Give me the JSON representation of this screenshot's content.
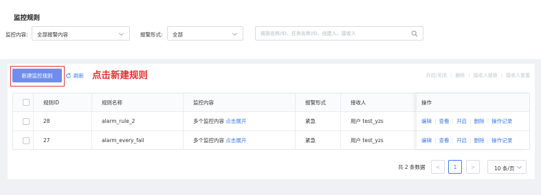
{
  "page": {
    "title": "监控规则"
  },
  "filters": {
    "content_label": "监控内容:",
    "content_value": "全部报警内容",
    "alarm_label": "报警形式:",
    "alarm_value": "全部",
    "search_placeholder": "规则名称/ID、任务名称/ID、创建人、接收人"
  },
  "toolbar": {
    "new_rule_label": "新建监控规则",
    "refresh_label": "刷新",
    "annotation": "点击新建规则",
    "batch_actions": [
      "开启/关闭",
      "删除",
      "接收人替换",
      "接收人重置"
    ]
  },
  "table": {
    "headers": [
      "规则ID",
      "规则名称",
      "监控内容",
      "报警形式",
      "接收人",
      "操作"
    ],
    "rows": [
      {
        "id": "28",
        "name": "alarm_rule_2",
        "content": "多个监控内容",
        "expand": "点击展开",
        "alarm": "紧急",
        "receiver": "用户 test_yzs"
      },
      {
        "id": "27",
        "name": "alarm_every_fail",
        "content": "多个监控内容",
        "expand": "点击展开",
        "alarm": "紧急",
        "receiver": "用户 test_yzs"
      }
    ],
    "row_actions": [
      "编辑",
      "查看",
      "开启",
      "删除",
      "操作记录"
    ]
  },
  "pagination": {
    "total_text": "共 2 条数据",
    "prev": "<",
    "current_page": "1",
    "next": ">",
    "page_size": "10 条/页"
  },
  "colors": {
    "primary": "#6f8dee",
    "link": "#3a78f2",
    "annotation": "#e3342f"
  }
}
